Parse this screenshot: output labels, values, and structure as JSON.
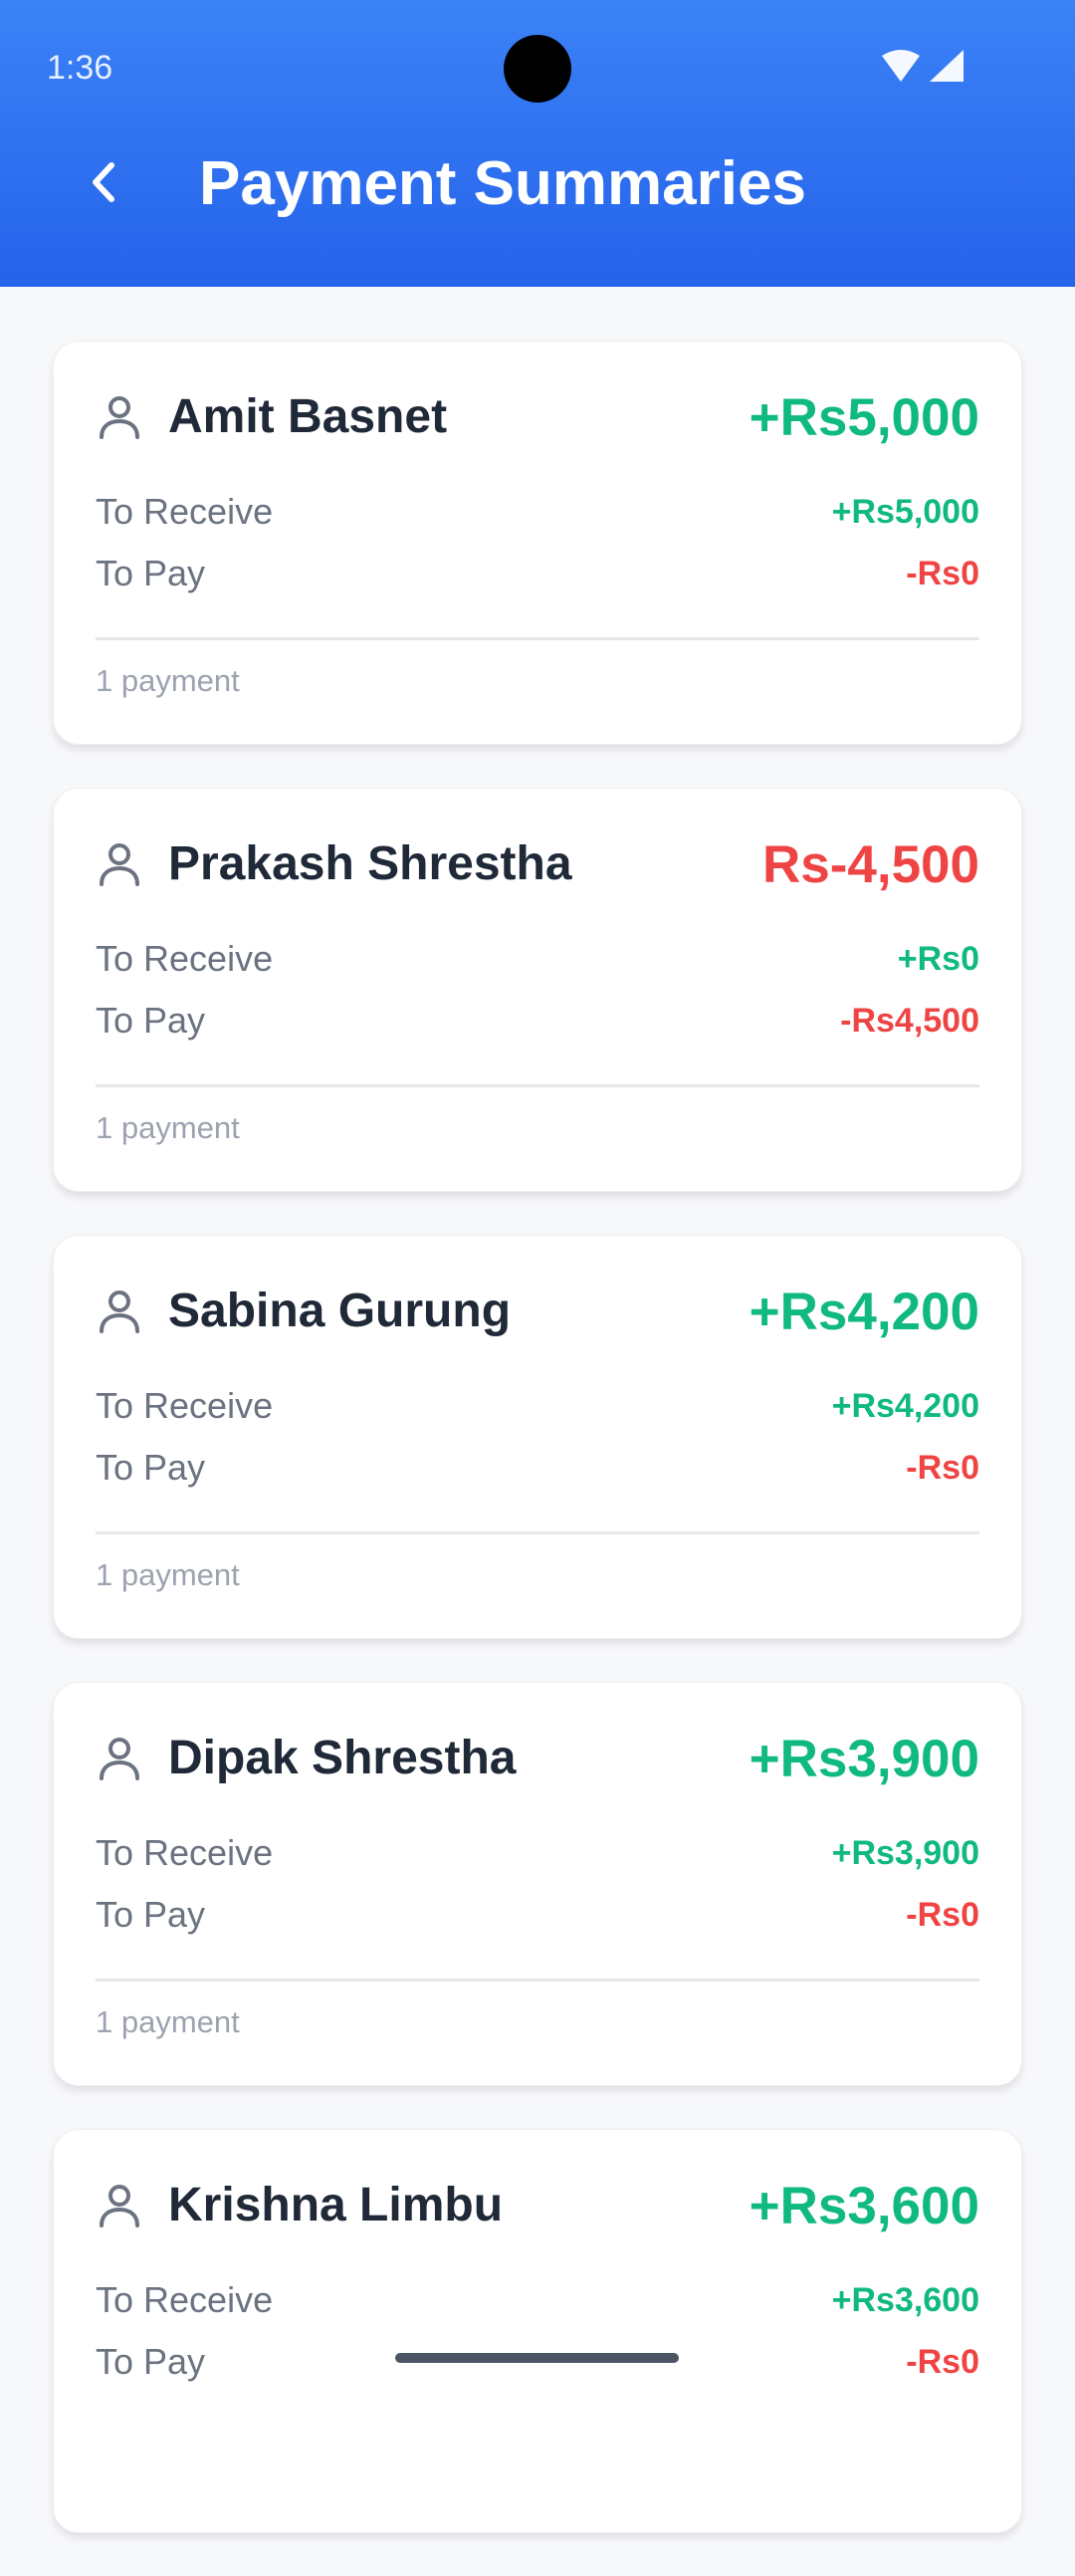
{
  "status_bar": {
    "time": "1:36"
  },
  "header": {
    "title": "Payment Summaries",
    "back_icon": "chevron-left-icon",
    "background": "#2563eb"
  },
  "colors": {
    "positive": "#10b981",
    "negative": "#ef4444"
  },
  "summaries": [
    {
      "name": "Amit Basnet",
      "net": "+Rs5,000",
      "net_sign": "positive",
      "receive_label": "To Receive",
      "receive_value": "+Rs5,000",
      "pay_label": "To Pay",
      "pay_value": "-Rs0",
      "payments": "1 payment"
    },
    {
      "name": "Prakash Shrestha",
      "net": "Rs-4,500",
      "net_sign": "negative",
      "receive_label": "To Receive",
      "receive_value": "+Rs0",
      "pay_label": "To Pay",
      "pay_value": "-Rs4,500",
      "payments": "1 payment"
    },
    {
      "name": "Sabina Gurung",
      "net": "+Rs4,200",
      "net_sign": "positive",
      "receive_label": "To Receive",
      "receive_value": "+Rs4,200",
      "pay_label": "To Pay",
      "pay_value": "-Rs0",
      "payments": "1 payment"
    },
    {
      "name": "Dipak Shrestha",
      "net": "+Rs3,900",
      "net_sign": "positive",
      "receive_label": "To Receive",
      "receive_value": "+Rs3,900",
      "pay_label": "To Pay",
      "pay_value": "-Rs0",
      "payments": "1 payment"
    },
    {
      "name": "Krishna Limbu",
      "net": "+Rs3,600",
      "net_sign": "positive",
      "receive_label": "To Receive",
      "receive_value": "+Rs3,600",
      "pay_label": "To Pay",
      "pay_value": "-Rs0",
      "payments": ""
    }
  ]
}
